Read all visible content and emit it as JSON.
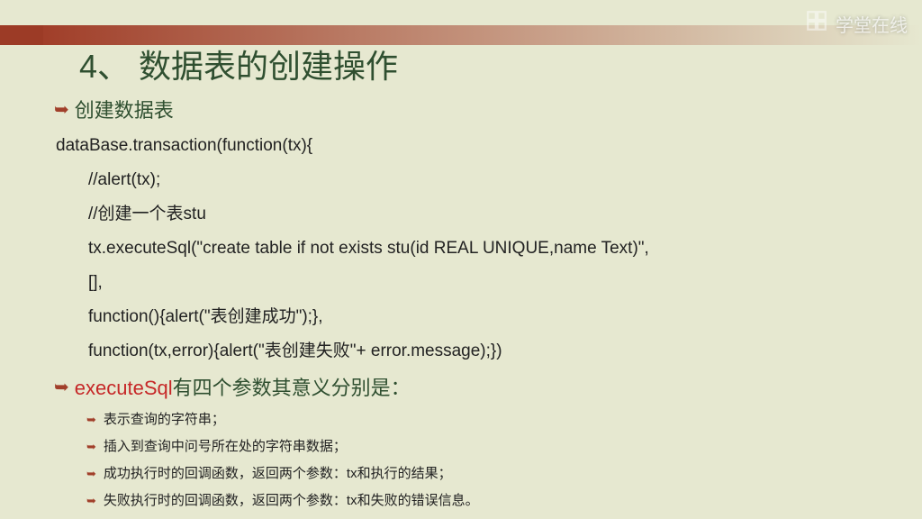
{
  "watermark": "学堂在线",
  "title": "4、 数据表的创建操作",
  "bullets": {
    "main1": "创建数据表",
    "main2_hl": "executeSql",
    "main2_rest": "有四个参数其意义分别是："
  },
  "code": {
    "l1": "dataBase.transaction(function(tx){",
    "l2": "//alert(tx);",
    "l3": "//创建一个表stu",
    "l4": "tx.executeSql(\"create table if not exists stu(id REAL UNIQUE,name Text)\",",
    "l5": "[],",
    "l6": "function(){alert(\"表创建成功\");},",
    "l7": "function(tx,error){alert(\"表创建失败\"+ error.message);})"
  },
  "sub": {
    "s1": "表示查询的字符串；",
    "s2": "插入到查询中问号所在处的字符串数据；",
    "s3": "成功执行时的回调函数，返回两个参数：tx和执行的结果；",
    "s4": "失败执行时的回调函数，返回两个参数：tx和失败的错误信息。"
  }
}
